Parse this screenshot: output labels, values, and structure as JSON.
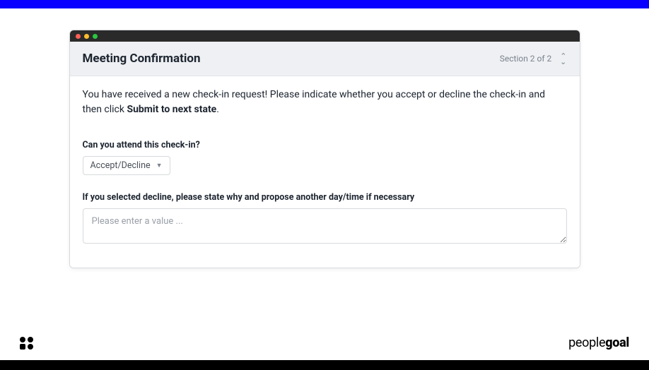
{
  "section": {
    "title": "Meeting Confirmation",
    "counter": "Section 2 of 2"
  },
  "intro": {
    "text_before": "You have received a new check-in request! Please indicate whether you accept or decline the check-in and then click ",
    "bold": "Submit to next state",
    "text_after": "."
  },
  "attend": {
    "label": "Can you attend this check-in?",
    "select_label": "Accept/Decline"
  },
  "decline": {
    "label": "If you selected decline, please state why and propose another day/time if necessary",
    "placeholder": "Please enter a value ..."
  },
  "brand": {
    "part1": "people",
    "part2": "goal"
  }
}
